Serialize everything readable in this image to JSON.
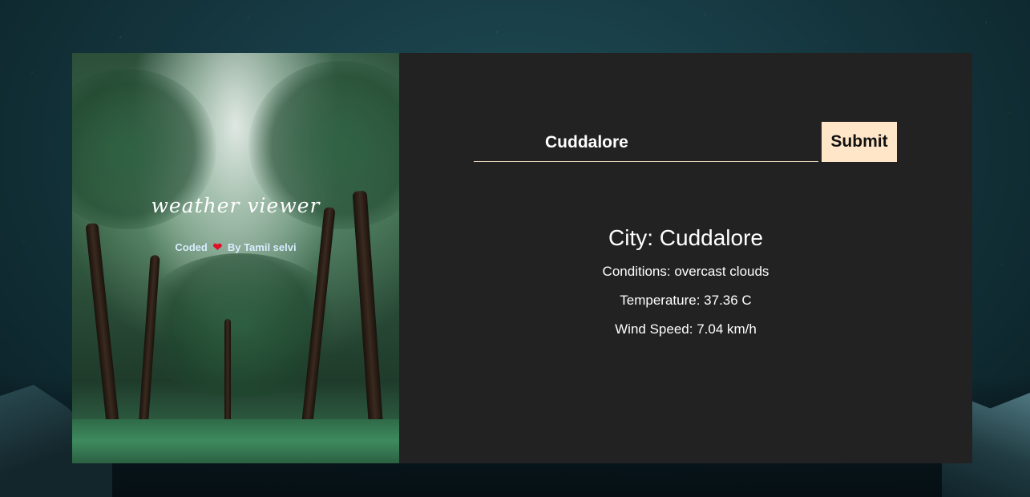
{
  "brand": {
    "title": "weather viewer",
    "credit_prefix": "Coded",
    "credit_suffix": "By Tamil selvi"
  },
  "search": {
    "value": "Cuddalore",
    "submit_label": "Submit"
  },
  "weather": {
    "city": "City: Cuddalore",
    "conditions": "Conditions: overcast clouds",
    "temperature": "Temperature: 37.36 C",
    "wind_speed": "Wind Speed: 7.04 km/h"
  },
  "colors": {
    "card_background": "#222222",
    "submit_background": "#ffe6c8",
    "input_underline": "#e8d6bd",
    "heart": "#e0102a"
  }
}
